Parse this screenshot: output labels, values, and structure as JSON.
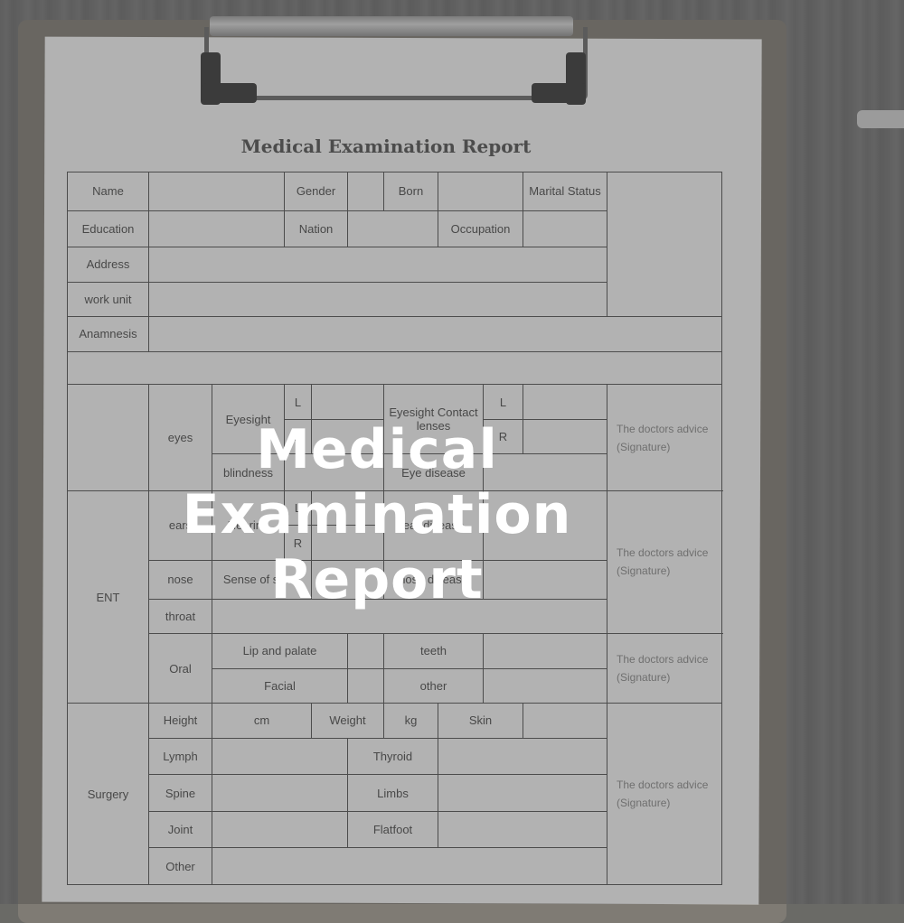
{
  "document": {
    "title": "Medical  Examination Report",
    "personal": {
      "name": "Name",
      "gender": "Gender",
      "born": "Born",
      "marital_status": "Marital Status",
      "education": "Education",
      "nation": "Nation",
      "occupation": "Occupation",
      "address": "Address",
      "work_unit": "work unit",
      "anamnesis": "Anamnesis"
    },
    "eyes": {
      "eyes": "eyes",
      "eyesight": "Eyesight",
      "l": "L",
      "r": "R",
      "contact_eyesight": "Eyesight Contact lenses",
      "color_blindness": "blindness",
      "eye_disease": "Eye disease"
    },
    "ent": {
      "ent": "ENT",
      "ears": "ears",
      "hearing": "Hearing",
      "l": "L",
      "r": "R",
      "ear_disease": "ear disease",
      "nose": "nose",
      "sense_of_smell": "Sense of smell",
      "nose_disease": "nose disease",
      "throat": "throat",
      "oral": "Oral",
      "lip_and_palate": "Lip and palate",
      "teeth": "teeth",
      "facial": "Facial",
      "other": "other"
    },
    "surgery": {
      "surgery": "Surgery",
      "height": "Height",
      "cm": "cm",
      "weight": "Weight",
      "kg": "kg",
      "skin": "Skin",
      "lymph": "Lymph",
      "thyroid": "Thyroid",
      "spine": "Spine",
      "limbs": "Limbs",
      "joint": "Joint",
      "flatfoot": "Flatfoot",
      "other": "Other"
    },
    "doctors_advice": "The doctors advice (Signature)"
  },
  "overlay": {
    "headline_line1": "Medical Examination",
    "headline_line2": "Report"
  }
}
